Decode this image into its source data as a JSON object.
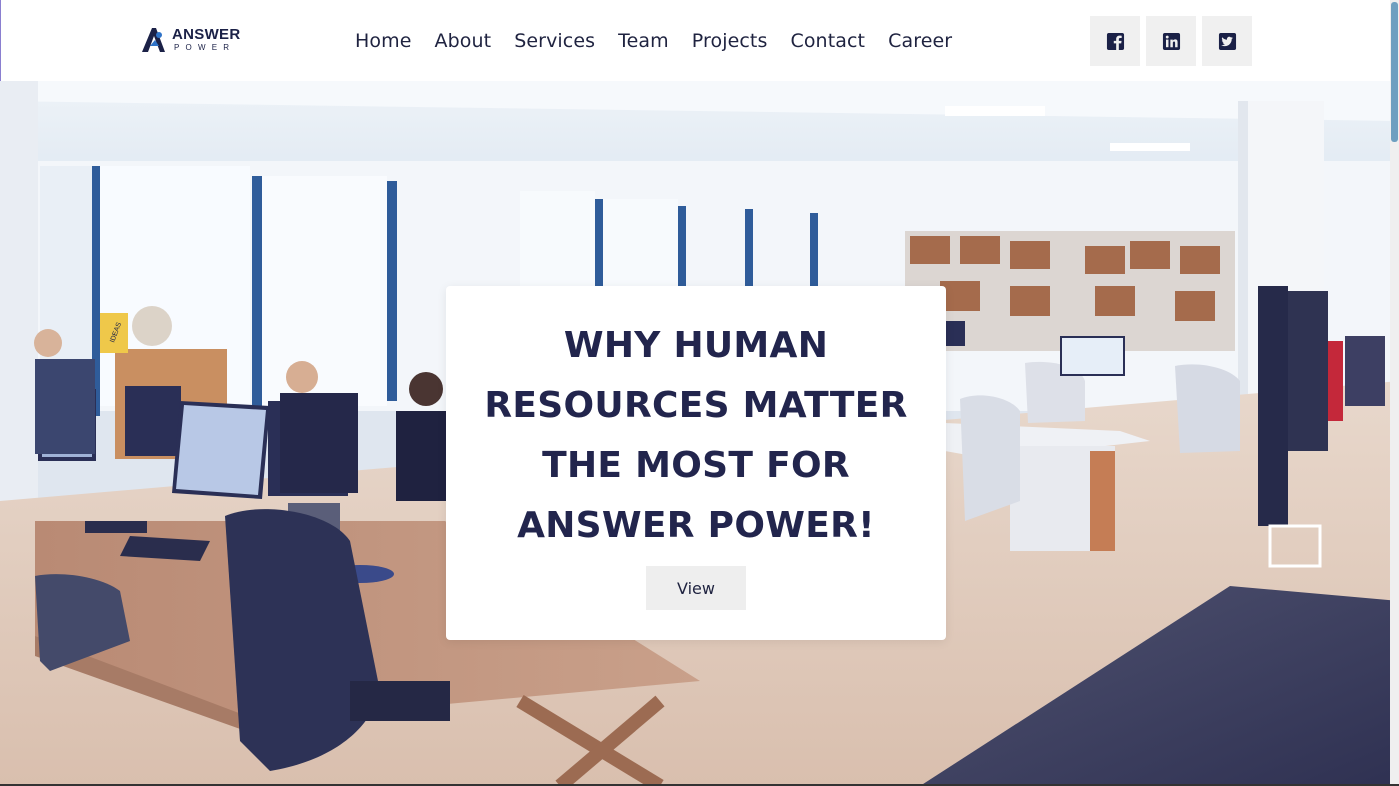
{
  "brand": {
    "name": "ANSWER",
    "tagline": "POWER",
    "logo_icon": "answer-power-logo"
  },
  "nav": {
    "items": [
      {
        "label": "Home"
      },
      {
        "label": "About"
      },
      {
        "label": "Services"
      },
      {
        "label": "Team"
      },
      {
        "label": "Projects"
      },
      {
        "label": "Contact"
      },
      {
        "label": "Career"
      }
    ]
  },
  "socials": [
    {
      "icon": "facebook-icon"
    },
    {
      "icon": "linkedin-icon"
    },
    {
      "icon": "twitter-icon"
    }
  ],
  "hero": {
    "title": "WHY HUMAN RESOURCES MATTER THE MOST FOR ANSWER POWER!",
    "button_label": "View",
    "signage": {
      "ideas": "IDEAS"
    }
  },
  "colors": {
    "title": "#22254d",
    "nav_text": "#1f2340",
    "social_bg": "#f0f0f0",
    "social_icon": "#1b2147",
    "accent_scroll": "#6e9fc0"
  }
}
